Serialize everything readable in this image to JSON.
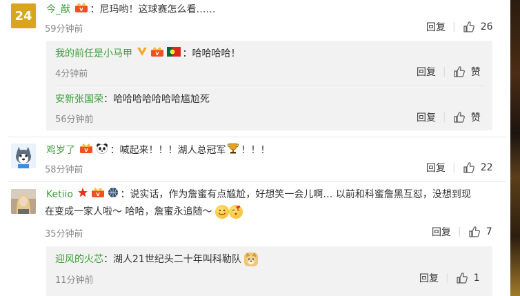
{
  "comments": [
    {
      "avatar_text": "24",
      "user": "今_猷",
      "text": "：尼玛哟！这球赛怎么看……",
      "time": "59分钟前",
      "reply_label": "回复",
      "likes": "26",
      "replies": [
        {
          "user": "我的前任是小马甲",
          "text": "：哈哈哈哈！",
          "time": "4分钟前",
          "reply_label": "回复",
          "likes": "赞"
        },
        {
          "user": "安新张国荣",
          "text": "：哈哈哈哈哈哈哈尴尬死",
          "time": "56分钟前",
          "reply_label": "回复",
          "likes": "赞"
        }
      ]
    },
    {
      "user": "鸡岁了",
      "text_a": "：喊起来！！！湖人总冠军",
      "text_b": "！！！",
      "time": "58分钟前",
      "reply_label": "回复",
      "likes": "22"
    },
    {
      "user": "Ketiio",
      "text_line1": "：说实话，作为詹蜜有点尴尬，好想笑一会儿啊… 以前和科蜜詹黑互怼，没想到现",
      "text_line2": "在变成一家人啦～  哈哈，詹蜜永追随～",
      "time": "35分钟前",
      "reply_label": "回复",
      "likes": "7",
      "replies": [
        {
          "user": "迎风的火芯",
          "text": "：湖人21世纪头二十年叫科勒队",
          "time": "11分钟前",
          "reply_label": "回复",
          "likes": "1"
        }
      ]
    }
  ],
  "icons": {
    "thumb": "thumbs-up-icon",
    "vip": "vip-crown-icon",
    "verified": "verified-v-icon",
    "flag": "portugal-flag-icon",
    "panda": "panda-icon",
    "trophy": "trophy-icon",
    "ball": "basketball-icon",
    "star": "red-star-icon",
    "smile": "smile-emoji-icon",
    "kiss": "kiss-emoji-icon",
    "doge": "doge-icon"
  },
  "colors": {
    "username": "#3c9e3a",
    "reply_bg": "#f2f2f2",
    "time": "#888888",
    "vip": "#f04e23"
  }
}
